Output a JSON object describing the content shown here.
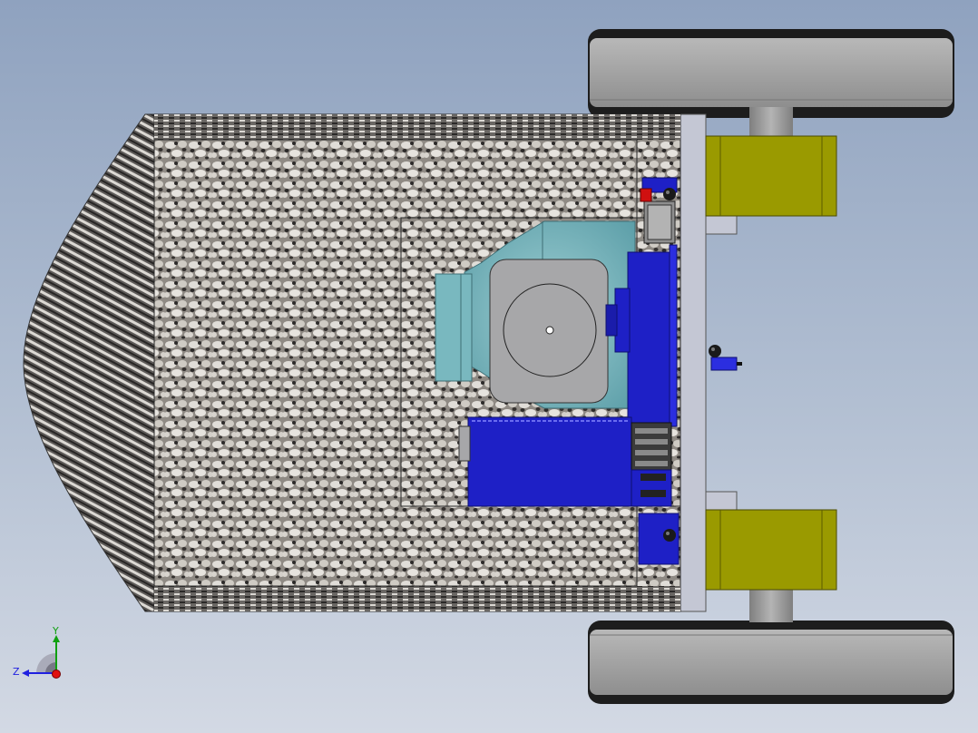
{
  "colors": {
    "background_top": "#8fa2bf",
    "background_bottom": "#d3d9e4",
    "carpet_base": "#8f8a84",
    "carpet_light": "#dedbd6",
    "carpet_dark": "#2d2b2a",
    "motor_blue": "#1e20c6",
    "motor_blue_dark": "#12158f",
    "teal_housing": "#6fb0b8",
    "gray_body": "#a7a7a9",
    "olive_block": "#9a9a00",
    "wheel_tire": "#1d1d1d",
    "wheel_rim": "#9b9b9b",
    "plate_gray": "#c4c7d4",
    "axis_x": "#e01010",
    "axis_y": "#10a010",
    "axis_z": "#2020e0"
  },
  "triad": {
    "y_label": "Y",
    "z_label": "Z",
    "icons": [
      "triad-x-arrow",
      "triad-y-arrow",
      "triad-z-arrow"
    ]
  }
}
